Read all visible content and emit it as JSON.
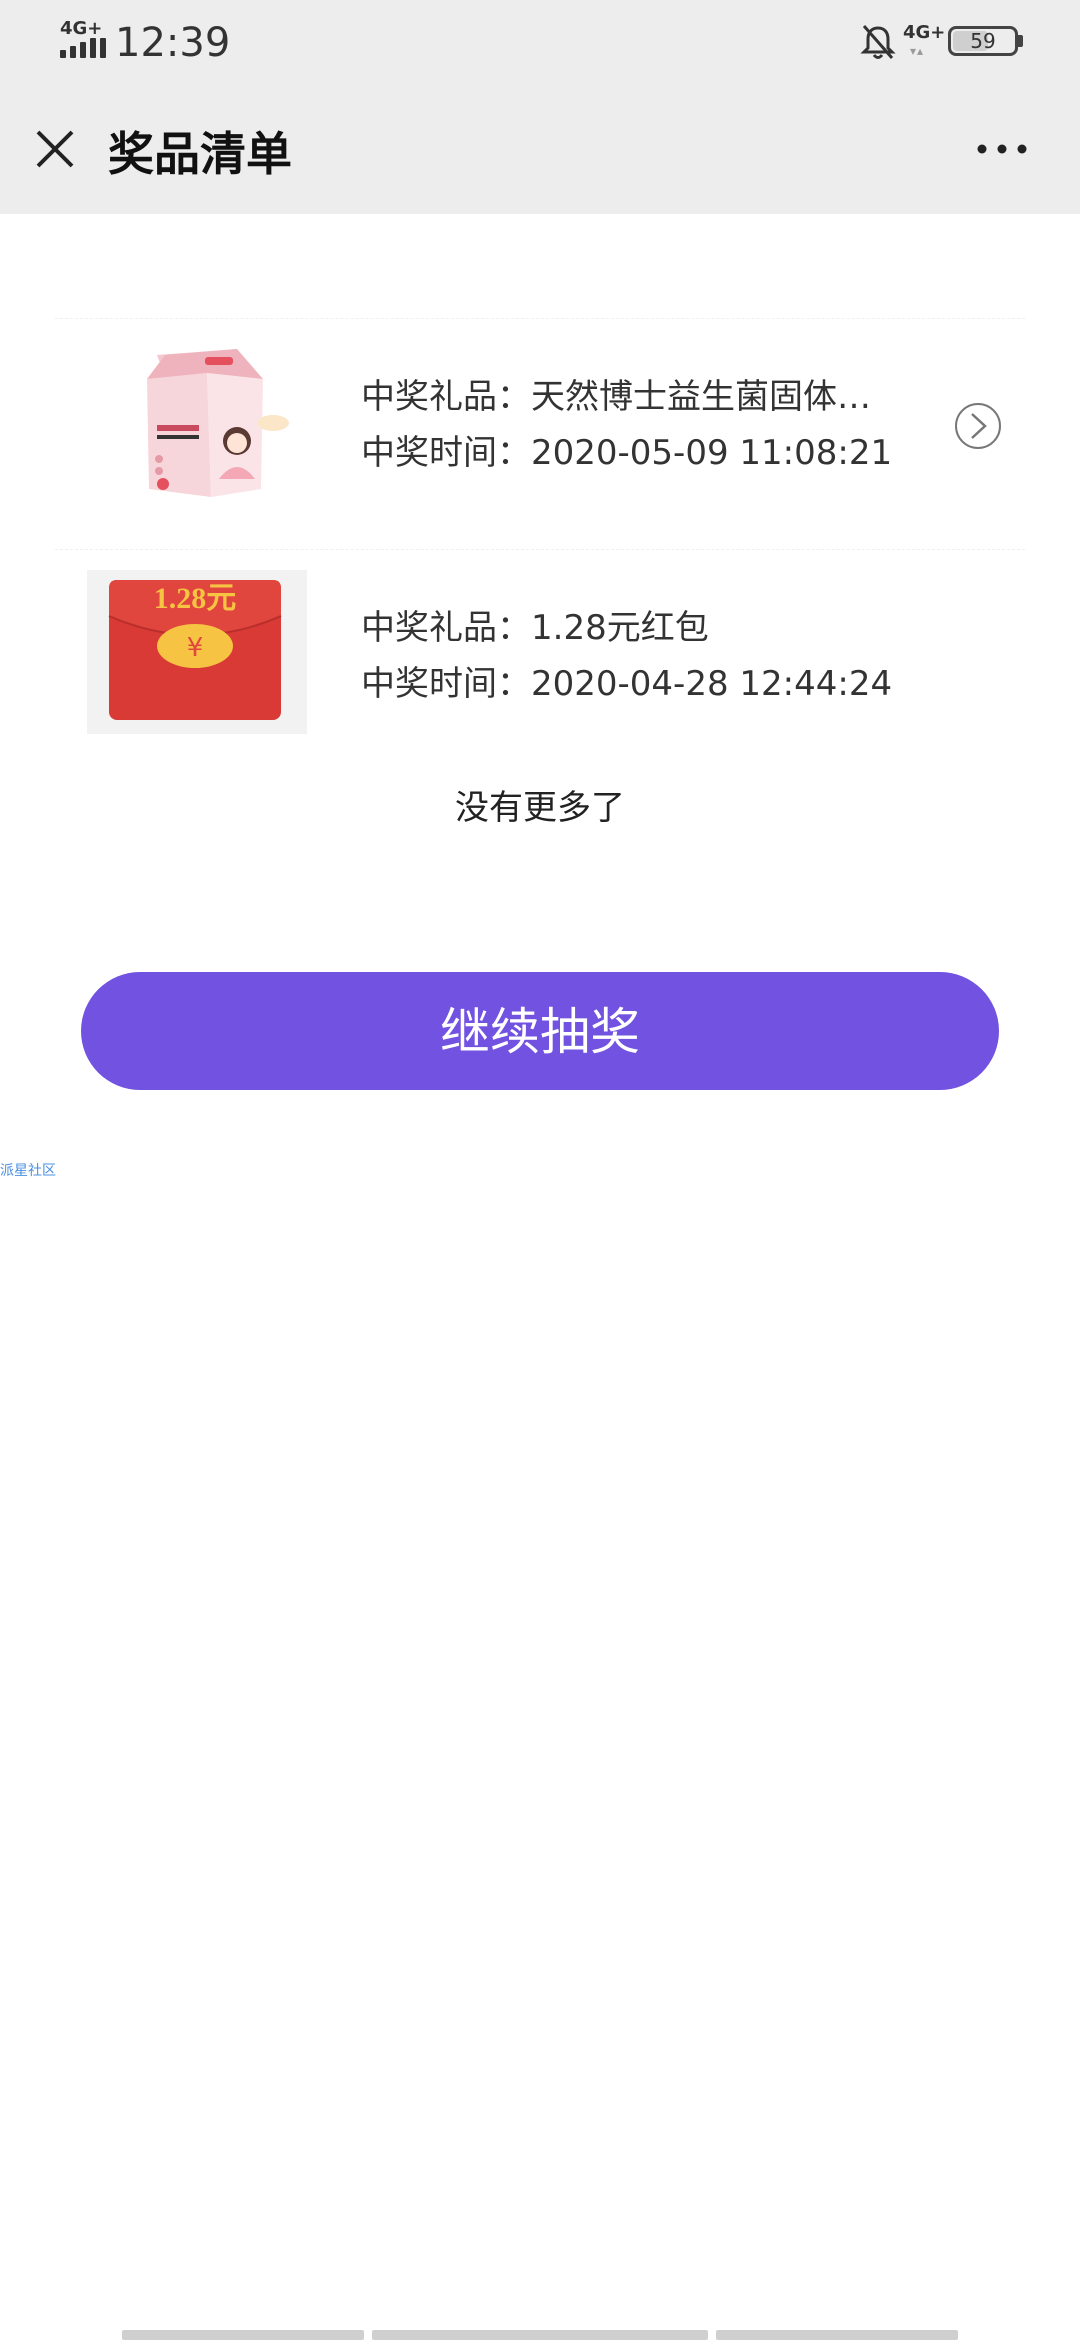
{
  "status_bar": {
    "signal_label": "4G+",
    "time": "12:39",
    "network_label": "4G+",
    "battery_level": "59",
    "icons": [
      "signal-icon",
      "bell-off-icon",
      "battery-icon"
    ]
  },
  "header": {
    "title": "奖品清单",
    "close_icon": "close-icon",
    "more_icon": "more-icon"
  },
  "prizes": [
    {
      "gift_label": "中奖礼品：",
      "gift_value": "天然博士益生菌固体…",
      "time_label": "中奖时间：",
      "time_value": "2020-05-09 11:08:21",
      "has_arrow": true
    },
    {
      "gift_label": "中奖礼品：",
      "gift_value": "1.28元红包",
      "time_label": "中奖时间：",
      "time_value": "2020-04-28 12:44:24",
      "image_text": "1.28元",
      "image_symbol": "¥",
      "has_arrow": false
    }
  ],
  "list_end_text": "没有更多了",
  "continue_button": "继续抽奖",
  "watermark": "派星社区",
  "colors": {
    "accent": "#7252e0",
    "header_bg": "#ededed",
    "red_envelope": "#d93a36",
    "coin_gold": "#f6c343"
  }
}
